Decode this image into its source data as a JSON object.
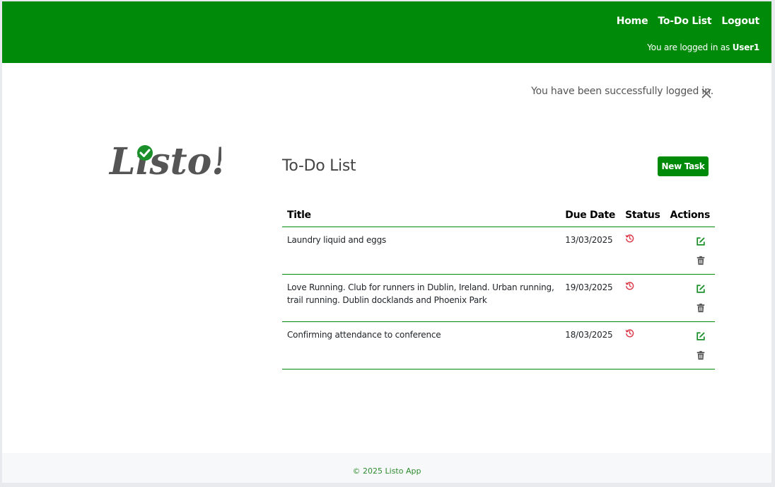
{
  "nav": {
    "links": [
      "Home",
      "To-Do List",
      "Logout"
    ],
    "login_prefix": "You are logged in as",
    "username": "User1"
  },
  "alert": {
    "message": "You have been successfully logged in.",
    "close_icon": "close-icon"
  },
  "logo": {
    "text": "Listo!"
  },
  "main": {
    "title": "To-Do List",
    "new_task_label": "New Task",
    "columns": [
      "Title",
      "Due Date",
      "Status",
      "Actions"
    ],
    "rows": [
      {
        "title": "Laundry liquid and eggs",
        "due": "13/03/2025",
        "status": "overdue"
      },
      {
        "title": "Love Running. Club for runners in Dublin, Ireland. Urban running, trail running. Dublin docklands and Phoenix Park",
        "due": "19/03/2025",
        "status": "overdue"
      },
      {
        "title": "Confirming attendance to conference",
        "due": "18/03/2025",
        "status": "overdue"
      }
    ]
  },
  "footer": {
    "text": "© 2025 Listo App"
  },
  "colors": {
    "brand": "#008a0a",
    "status_overdue": "#dc3545",
    "delete_icon": "#555555"
  }
}
